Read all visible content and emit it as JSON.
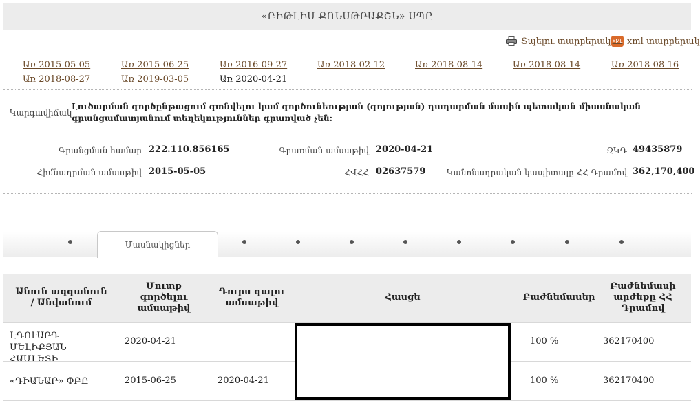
{
  "header": {
    "title": "«ԲԻԹԼԻՍ ՔՈՆՍԹՐԱՔՇՆ» ՍՊԸ"
  },
  "toolbar": {
    "print_label": "Տպելու տարբերակ",
    "xml_label": "xml տարբերակ",
    "xml_icon_text": "XML"
  },
  "dates": {
    "links": [
      "Առ 2015-05-05",
      "Առ 2015-06-25",
      "Առ 2016-09-27",
      "Առ 2018-02-12",
      "Առ 2018-08-14",
      "Առ 2018-08-14",
      "Առ 2018-08-16",
      "Առ 2018-08-27",
      "Առ 2019-03-05"
    ],
    "current": "Առ 2020-04-21"
  },
  "status": {
    "label": "Կարգավիճակ",
    "text": "Լուծարման գործընթացում գտնվելու կամ գործունեության (գոյության) դադարման մասին պետական միասնական գրանցամատյանում տեղեկություններ գրառված չեն:"
  },
  "info": {
    "reg_number_label": "Գրանցման համար",
    "reg_number": "222.110.856165",
    "record_date_label": "Գրառման ամսաթիվ",
    "record_date": "2020-04-21",
    "tin_label": "ՀՎՀՀ",
    "tin": "02637579",
    "zkd_label": "ԶԿԴ",
    "zkd": "49435879",
    "founding_date_label": "Հիմնադրման ամսաթիվ",
    "founding_date": "2015-05-05",
    "capital_label": "Կանոնադրական կապիտալը ՀՀ Դրամով",
    "capital": "362,170,400"
  },
  "tabs": {
    "active_label": "Մասնակիցներ"
  },
  "table": {
    "headers": {
      "name": "Անուն ազգանուն / Անվանում",
      "entry": "Մուտք գործելու ամսաթիվ",
      "exit": "Դուրս գալու ամսաթիվ",
      "address": "Հասցե",
      "shares": "Բաժնեմասեր",
      "share_value": "Բաժնեմասի արժեքը ՀՀ Դրամով"
    },
    "rows": [
      {
        "name": "ԷԴՈՒԱՐԴ ՄԵԼԻՔՅԱՆ ՀԱՄԼԵՏԻ",
        "entry": "2020-04-21",
        "exit": "",
        "shares": "100 %",
        "value": "362170400"
      },
      {
        "name": "«ԴԻԱՆԱՐ» ՓԲԸ",
        "entry": "2015-06-25",
        "exit": "2020-04-21",
        "shares": "100 %",
        "value": "362170400"
      }
    ]
  },
  "colors": {
    "link": "#6b4a2a",
    "header_bg": "#ececec"
  }
}
